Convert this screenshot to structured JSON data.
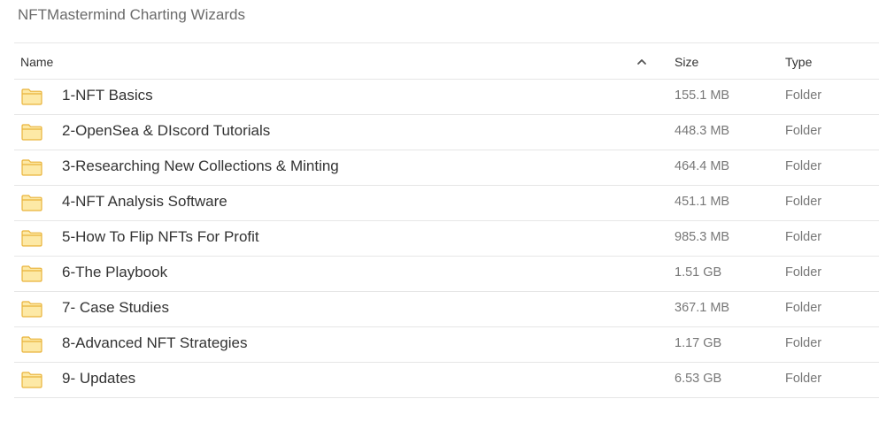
{
  "breadcrumb": "NFTMastermind Charting Wizards",
  "columns": {
    "name": "Name",
    "size": "Size",
    "type": "Type"
  },
  "sort_icon": "chevron-up-icon",
  "folder_icon": "folder-icon",
  "colors": {
    "folder_fill": "#fde9a6",
    "folder_stroke": "#e9b33a",
    "divider": "#e6e6e6",
    "secondary_text": "#777777"
  },
  "items": [
    {
      "name": "1-NFT Basics",
      "size": "155.1 MB",
      "type": "Folder"
    },
    {
      "name": "2-OpenSea & DIscord Tutorials",
      "size": "448.3 MB",
      "type": "Folder"
    },
    {
      "name": "3-Researching New Collections & Minting",
      "size": "464.4 MB",
      "type": "Folder"
    },
    {
      "name": "4-NFT Analysis Software",
      "size": "451.1 MB",
      "type": "Folder"
    },
    {
      "name": "5-How To Flip NFTs For Profit",
      "size": "985.3 MB",
      "type": "Folder"
    },
    {
      "name": "6-The Playbook",
      "size": "1.51 GB",
      "type": "Folder"
    },
    {
      "name": "7- Case Studies",
      "size": "367.1 MB",
      "type": "Folder"
    },
    {
      "name": "8-Advanced NFT Strategies",
      "size": "1.17 GB",
      "type": "Folder"
    },
    {
      "name": "9- Updates",
      "size": "6.53 GB",
      "type": "Folder"
    }
  ]
}
